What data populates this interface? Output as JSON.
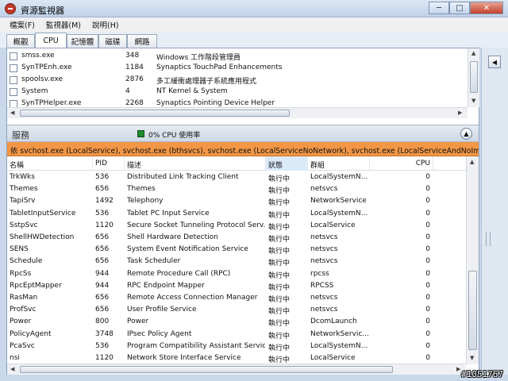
{
  "window": {
    "title": "資源監視器",
    "minimize": "─",
    "maximize": "□",
    "close": "✕"
  },
  "menu": [
    "檔案(F)",
    "監視器(M)",
    "說明(H)"
  ],
  "tabs": [
    "概觀",
    "CPU",
    "記憶體",
    "磁碟",
    "網路"
  ],
  "processes": [
    {
      "name": "smss.exe",
      "pid": "348",
      "desc": "Windows 工作階段管理員"
    },
    {
      "name": "SynTPEnh.exe",
      "pid": "1184",
      "desc": "Synaptics TouchPad Enhancements"
    },
    {
      "name": "spoolsv.exe",
      "pid": "2876",
      "desc": "多工緩衝處理器子系統應用程式"
    },
    {
      "name": "System",
      "pid": "4",
      "desc": "NT Kernel & System"
    },
    {
      "name": "SynTPHelper.exe",
      "pid": "2268",
      "desc": "Synaptics Pointing Device Helper"
    }
  ],
  "services": {
    "title": "服務",
    "cpu_usage": "0% CPU 使用率",
    "filter": "依 svchost.exe (LocalService), svchost.exe (bthsvcs), svchost.exe (LocalServiceNoNetwork), svchost.exe (LocalServiceAndNoImp...",
    "columns": [
      "名稱",
      "PID",
      "描述",
      "狀態",
      "群組",
      "CPU"
    ],
    "rows": [
      [
        "TrkWks",
        "536",
        "Distributed Link Tracking Client",
        "執行中",
        "LocalSystemN...",
        "0"
      ],
      [
        "Themes",
        "656",
        "Themes",
        "執行中",
        "netsvcs",
        "0"
      ],
      [
        "TapiSrv",
        "1492",
        "Telephony",
        "執行中",
        "NetworkService",
        "0"
      ],
      [
        "TabletInputService",
        "536",
        "Tablet PC Input Service",
        "執行中",
        "LocalSystemN...",
        "0"
      ],
      [
        "SstpSvc",
        "1120",
        "Secure Socket Tunneling Protocol Serv...",
        "執行中",
        "LocalService",
        "0"
      ],
      [
        "ShellHWDetection",
        "656",
        "Shell Hardware Detection",
        "執行中",
        "netsvcs",
        "0"
      ],
      [
        "SENS",
        "656",
        "System Event Notification Service",
        "執行中",
        "netsvcs",
        "0"
      ],
      [
        "Schedule",
        "656",
        "Task Scheduler",
        "執行中",
        "netsvcs",
        "0"
      ],
      [
        "RpcSs",
        "944",
        "Remote Procedure Call (RPC)",
        "執行中",
        "rpcss",
        "0"
      ],
      [
        "RpcEptMapper",
        "944",
        "RPC Endpoint Mapper",
        "執行中",
        "RPCSS",
        "0"
      ],
      [
        "RasMan",
        "656",
        "Remote Access Connection Manager",
        "執行中",
        "netsvcs",
        "0"
      ],
      [
        "ProfSvc",
        "656",
        "User Profile Service",
        "執行中",
        "netsvcs",
        "0"
      ],
      [
        "Power",
        "800",
        "Power",
        "執行中",
        "DcomLaunch",
        "0"
      ],
      [
        "PolicyAgent",
        "3748",
        "IPsec Policy Agent",
        "執行中",
        "NetworkServic...",
        "0"
      ],
      [
        "PcaSvc",
        "536",
        "Program Compatibility Assistant Service",
        "執行中",
        "LocalSystemN...",
        "0"
      ],
      [
        "nsi",
        "1120",
        "Network Store Interface Service",
        "執行中",
        "LocalService",
        "0"
      ]
    ]
  },
  "watermark": "#1051767"
}
